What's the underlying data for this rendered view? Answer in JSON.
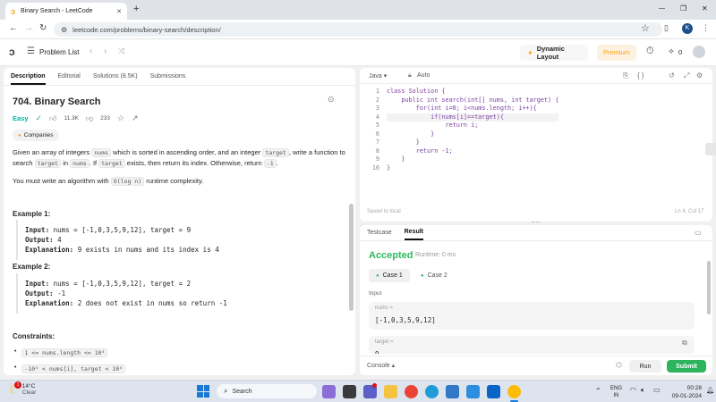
{
  "browser": {
    "tab_title": "Binary Search - LeetCode",
    "new_tab": "+",
    "url": "leetcode.com/problems/binary-search/description/",
    "profile_initial": "K",
    "window_min": "—",
    "window_max": "❐",
    "window_close": "✕"
  },
  "lc_nav": {
    "problem_list": "Problem List",
    "dynamic_layout": "Dynamic Layout",
    "premium": "Premium",
    "points": "0"
  },
  "left_panel": {
    "tabs": [
      {
        "label": "Description",
        "active": true
      },
      {
        "label": "Editorial"
      },
      {
        "label": "Solutions (8.5K)"
      },
      {
        "label": "Submissions"
      }
    ],
    "title": "704. Binary Search",
    "difficulty": "Easy",
    "likes": "11.3K",
    "dislikes": "233",
    "companies": "Companies",
    "desc_1": "Given an array of integers",
    "desc_nums": "nums",
    "desc_2": "which is sorted in ascending order, and an integer",
    "desc_target": "target",
    "desc_3": ", write a function to search",
    "desc_4": "in",
    "desc_5": ". If",
    "desc_6": "exists, then return its index. Otherwise, return",
    "desc_neg1": "-1",
    "desc_7": "You must write an algorithm with",
    "desc_complexity": "O(log n)",
    "desc_8": "runtime complexity.",
    "example1_title": "Example 1:",
    "example1_input_label": "Input:",
    "example1_input": "nums = [-1,0,3,5,9,12], target = 9",
    "example1_output_label": "Output:",
    "example1_output": "4",
    "example1_expl_label": "Explanation:",
    "example1_expl": "9 exists in nums and its index is 4",
    "example2_title": "Example 2:",
    "example2_input_label": "Input:",
    "example2_input": "nums = [-1,0,3,5,9,12], target = 2",
    "example2_output_label": "Output:",
    "example2_output": "-1",
    "example2_expl_label": "Explanation:",
    "example2_expl": "2 does not exist in nums so return -1",
    "constraints_title": "Constraints:",
    "constraint1": "1 <= nums.length <= 10⁴",
    "constraint2": "-10⁴ < nums[i], target < 10⁴"
  },
  "editor": {
    "language": "Java",
    "mode": "Auto",
    "lines": [
      "class Solution {",
      "    public int search(int[] nums, int target) {",
      "        for(int i=0; i<nums.length; i++){",
      "            if(nums[i]==target){",
      "                return i;",
      "            }",
      "        }",
      "        return -1;",
      "    }",
      "}"
    ],
    "line_numbers": [
      "1",
      "2",
      "3",
      "4",
      "5",
      "6",
      "7",
      "8",
      "9",
      "10"
    ],
    "saved_status": "Saved to local",
    "cursor": "Ln 4, Col 17"
  },
  "result_panel": {
    "tab_testcase": "Testcase",
    "tab_result": "Result",
    "status": "Accepted",
    "runtime": "Runtime: 0 ms",
    "case1": "Case 1",
    "case2": "Case 2",
    "input_label": "Input",
    "nums_label": "nums =",
    "nums_value": "[-1,0,3,5,9,12]",
    "target_label": "target =",
    "target_value": "9",
    "console": "Console",
    "run": "Run",
    "submit": "Submit"
  },
  "taskbar": {
    "weather_temp": "14°C",
    "weather_desc": "Clear",
    "weather_badge": "1",
    "search": "Search",
    "lang_1": "ENG",
    "lang_2": "IN",
    "time": "00:28",
    "date": "09-01-2024"
  },
  "colors": {
    "accent_orange": "#ffa116",
    "easy_green": "#00b8a3",
    "accepted_green": "#2cbb5d",
    "submit_green": "#2db55d"
  }
}
